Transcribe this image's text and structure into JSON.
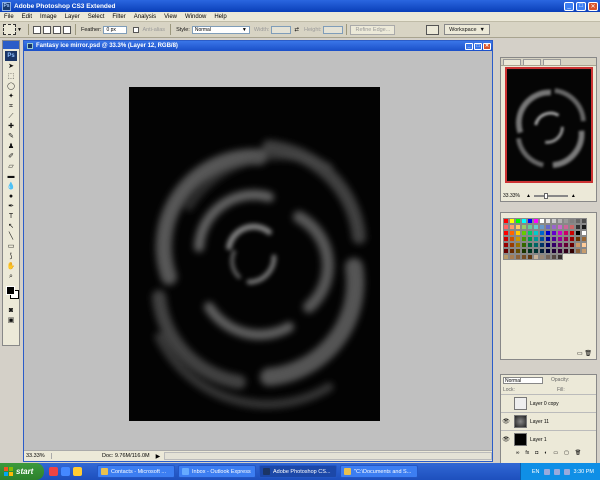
{
  "app": {
    "title": "Adobe Photoshop CS3 Extended",
    "logo": "Ps"
  },
  "menu": [
    "File",
    "Edit",
    "Image",
    "Layer",
    "Select",
    "Filter",
    "Analysis",
    "View",
    "Window",
    "Help"
  ],
  "options": {
    "feather_label": "Feather:",
    "feather_value": "0 px",
    "antialias_label": "Anti-alias",
    "style_label": "Style:",
    "style_value": "Normal",
    "width_label": "Width:",
    "height_label": "Height:",
    "refine_edge": "Refine Edge...",
    "workspace": "Workspace"
  },
  "document": {
    "title": "Fantasy ice mirror.psd @ 33.3% (Layer 12, RGB/8)",
    "zoom": "33.33%",
    "doc_size": "Doc: 9.76M/116.0M"
  },
  "navigator": {
    "zoom": "33.33%"
  },
  "swatches": {
    "colors": [
      "#ff0000",
      "#ffff00",
      "#00ff00",
      "#00ffff",
      "#0000ff",
      "#ff00ff",
      "#ffffff",
      "#e6e6e6",
      "#cccccc",
      "#b3b3b3",
      "#999999",
      "#808080",
      "#666666",
      "#4d4d4d",
      "#ff6666",
      "#ff9966",
      "#ffcc66",
      "#99cc66",
      "#66cc99",
      "#66cccc",
      "#6699cc",
      "#6666cc",
      "#9966cc",
      "#cc66cc",
      "#cc6699",
      "#cc6666",
      "#333333",
      "#1a1a1a",
      "#ff0000",
      "#ff6600",
      "#ffcc00",
      "#66cc00",
      "#00cc66",
      "#00cccc",
      "#0066cc",
      "#0000cc",
      "#6600cc",
      "#cc00cc",
      "#cc0066",
      "#cc0000",
      "#000000",
      "#ffffff",
      "#cc0000",
      "#cc5200",
      "#cc9900",
      "#4d9900",
      "#009952",
      "#009999",
      "#004d99",
      "#000099",
      "#4d0099",
      "#990099",
      "#99004d",
      "#990000",
      "#663300",
      "#996633",
      "#990000",
      "#993d00",
      "#997300",
      "#336600",
      "#00663d",
      "#006666",
      "#003366",
      "#000066",
      "#330066",
      "#660066",
      "#660033",
      "#660000",
      "#cc9966",
      "#ffcc99",
      "#660000",
      "#662900",
      "#664d00",
      "#1a3300",
      "#003320",
      "#003333",
      "#001a33",
      "#000033",
      "#1a0033",
      "#330033",
      "#33001a",
      "#330000",
      "#8c6239",
      "#c69c6d",
      "#b89a6a",
      "#a67c52",
      "#8c6239",
      "#754c24",
      "#603913",
      "#c7b299",
      "#998675",
      "#736357",
      "#534741",
      "#362f2d"
    ]
  },
  "layers": {
    "blend_mode": "Normal",
    "opacity_label": "Opacity:",
    "lock_label": "Lock:",
    "fill_label": "Fill:",
    "items": [
      {
        "name": "Layer 0 copy",
        "visible": false
      },
      {
        "name": "Layer 11",
        "visible": true
      },
      {
        "name": "Layer 1",
        "visible": true
      }
    ]
  },
  "taskbar": {
    "start": "start",
    "tasks": [
      {
        "label": "Contacts - Microsoft ...",
        "active": false
      },
      {
        "label": "Inbox - Outlook Express",
        "active": false
      },
      {
        "label": "Adobe Photoshop CS...",
        "active": true
      },
      {
        "label": "\"C:\\Documents and S...",
        "active": false
      }
    ],
    "lang": "EN",
    "clock": "3:30 PM"
  }
}
